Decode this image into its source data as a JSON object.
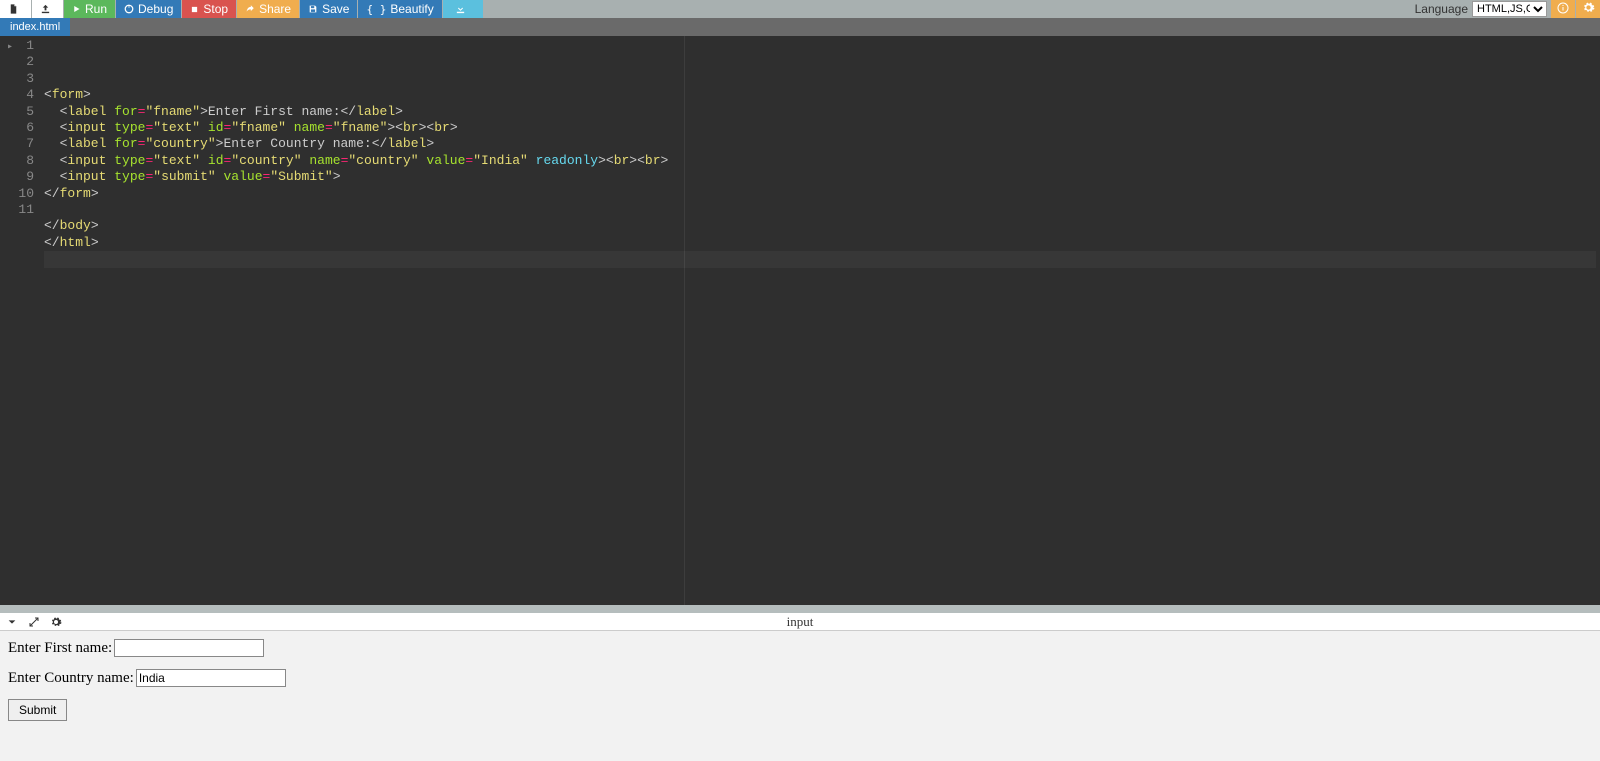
{
  "toolbar": {
    "run": "Run",
    "debug": "Debug",
    "stop": "Stop",
    "share": "Share",
    "save": "Save",
    "beautify": "Beautify",
    "language_label": "Language",
    "language_value": "HTML,JS,CSS"
  },
  "tabs": {
    "active": "index.html"
  },
  "editor": {
    "lines": [
      {
        "n": 1,
        "fold": true,
        "segs": [
          [
            "pun",
            "<"
          ],
          [
            "tagb",
            "form"
          ],
          [
            "pun",
            ">"
          ]
        ]
      },
      {
        "n": 2,
        "segs": [
          [
            "pun",
            "  <"
          ],
          [
            "tagb",
            "label"
          ],
          [
            "pun",
            " "
          ],
          [
            "attr",
            "for"
          ],
          [
            "eq",
            "="
          ],
          [
            "str",
            "\"fname\""
          ],
          [
            "pun",
            ">"
          ],
          [
            "pun",
            "Enter First name:"
          ],
          [
            "pun",
            "</"
          ],
          [
            "tagb",
            "label"
          ],
          [
            "pun",
            ">"
          ]
        ]
      },
      {
        "n": 3,
        "segs": [
          [
            "pun",
            "  <"
          ],
          [
            "tagb",
            "input"
          ],
          [
            "pun",
            " "
          ],
          [
            "attr",
            "type"
          ],
          [
            "eq",
            "="
          ],
          [
            "str",
            "\"text\""
          ],
          [
            "pun",
            " "
          ],
          [
            "attr",
            "id"
          ],
          [
            "eq",
            "="
          ],
          [
            "str",
            "\"fname\""
          ],
          [
            "pun",
            " "
          ],
          [
            "attr",
            "name"
          ],
          [
            "eq",
            "="
          ],
          [
            "str",
            "\"fname\""
          ],
          [
            "pun",
            "><"
          ],
          [
            "tagb",
            "br"
          ],
          [
            "pun",
            "><"
          ],
          [
            "tagb",
            "br"
          ],
          [
            "pun",
            ">"
          ]
        ]
      },
      {
        "n": 4,
        "segs": [
          [
            "pun",
            "  <"
          ],
          [
            "tagb",
            "label"
          ],
          [
            "pun",
            " "
          ],
          [
            "attr",
            "for"
          ],
          [
            "eq",
            "="
          ],
          [
            "str",
            "\"country\""
          ],
          [
            "pun",
            ">"
          ],
          [
            "pun",
            "Enter Country name:"
          ],
          [
            "pun",
            "</"
          ],
          [
            "tagb",
            "label"
          ],
          [
            "pun",
            ">"
          ]
        ]
      },
      {
        "n": 5,
        "segs": [
          [
            "pun",
            "  <"
          ],
          [
            "tagb",
            "input"
          ],
          [
            "pun",
            " "
          ],
          [
            "attr",
            "type"
          ],
          [
            "eq",
            "="
          ],
          [
            "str",
            "\"text\""
          ],
          [
            "pun",
            " "
          ],
          [
            "attr",
            "id"
          ],
          [
            "eq",
            "="
          ],
          [
            "str",
            "\"country\""
          ],
          [
            "pun",
            " "
          ],
          [
            "attr",
            "name"
          ],
          [
            "eq",
            "="
          ],
          [
            "str",
            "\"country\""
          ],
          [
            "pun",
            " "
          ],
          [
            "attr",
            "value"
          ],
          [
            "eq",
            "="
          ],
          [
            "str",
            "\"India\""
          ],
          [
            "pun",
            " "
          ],
          [
            "kw",
            "readonly"
          ],
          [
            "pun",
            "><"
          ],
          [
            "tagb",
            "br"
          ],
          [
            "pun",
            "><"
          ],
          [
            "tagb",
            "br"
          ],
          [
            "pun",
            ">"
          ]
        ]
      },
      {
        "n": 6,
        "segs": [
          [
            "pun",
            "  <"
          ],
          [
            "tagb",
            "input"
          ],
          [
            "pun",
            " "
          ],
          [
            "attr",
            "type"
          ],
          [
            "eq",
            "="
          ],
          [
            "str",
            "\"submit\""
          ],
          [
            "pun",
            " "
          ],
          [
            "attr",
            "value"
          ],
          [
            "eq",
            "="
          ],
          [
            "str",
            "\"Submit\""
          ],
          [
            "pun",
            ">"
          ]
        ]
      },
      {
        "n": 7,
        "segs": [
          [
            "pun",
            "</"
          ],
          [
            "tagb",
            "form"
          ],
          [
            "pun",
            ">"
          ]
        ]
      },
      {
        "n": 8,
        "segs": []
      },
      {
        "n": 9,
        "segs": [
          [
            "pun",
            "</"
          ],
          [
            "tagb",
            "body"
          ],
          [
            "pun",
            ">"
          ]
        ]
      },
      {
        "n": 10,
        "segs": [
          [
            "pun",
            "</"
          ],
          [
            "tagb",
            "html"
          ],
          [
            "pun",
            ">"
          ]
        ]
      },
      {
        "n": 11,
        "active": true,
        "segs": []
      }
    ]
  },
  "output": {
    "title": "input",
    "fname_label": "Enter First name:",
    "fname_value": "",
    "country_label": "Enter Country name:",
    "country_value": "India",
    "submit_label": "Submit"
  }
}
